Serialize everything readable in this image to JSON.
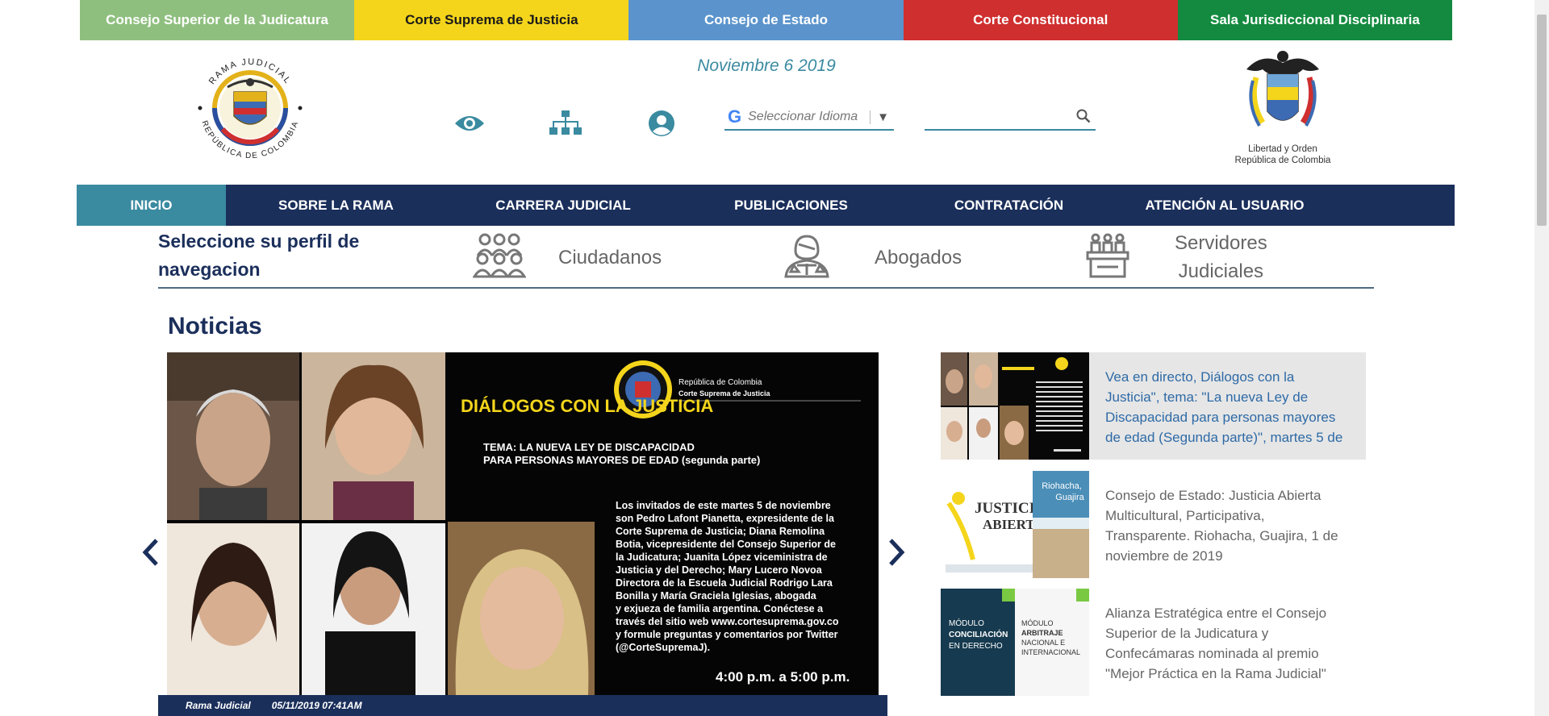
{
  "top_links": [
    {
      "label": "Consejo Superior de la Judicatura",
      "color": "#8fbf7f"
    },
    {
      "label": "Corte Suprema de Justicia",
      "color": "#f4d51b"
    },
    {
      "label": "Consejo de Estado",
      "color": "#5b94cc"
    },
    {
      "label": "Corte Constitucional",
      "color": "#cf2f2f"
    },
    {
      "label": "Sala Jurisdiccional Disciplinaria",
      "color": "#138a3f"
    }
  ],
  "header": {
    "left_logo_text_top": "RAMA JUDICIAL",
    "left_logo_text_bottom": "REPÚBLICA DE COLOMBIA",
    "date": "Noviembre 6 2019",
    "right_logo_caption_1": "Libertad y Orden",
    "right_logo_caption_2": "República de Colombia",
    "icons": [
      "eye-icon",
      "sitemap-icon",
      "user-circle-icon"
    ],
    "language_selector": {
      "label": "Seleccionar Idioma",
      "google_glyph": "G",
      "arrow": "▼"
    },
    "search": {
      "value": "",
      "placeholder": ""
    }
  },
  "nav": {
    "items": [
      {
        "label": "INICIO",
        "active": true
      },
      {
        "label": "SOBRE LA RAMA",
        "active": false
      },
      {
        "label": "CARRERA JUDICIAL",
        "active": false
      },
      {
        "label": "PUBLICACIONES",
        "active": false
      },
      {
        "label": "CONTRATACIÓN",
        "active": false
      },
      {
        "label": "ATENCIÓN AL USUARIO",
        "active": false
      }
    ],
    "active_color": "#3a8aa0",
    "bg_color": "#1b2f5b"
  },
  "profile": {
    "title_line1": "Seleccione su perfil de",
    "title_line2": "navegacion",
    "options": [
      {
        "label": "Ciudadanos",
        "icon": "citizens-icon"
      },
      {
        "label": "Abogados",
        "icon": "lawyer-icon"
      },
      {
        "label_line1": "Servidores",
        "label_line2": "Judiciales",
        "icon": "servants-icon"
      }
    ]
  },
  "news": {
    "title": "Noticias",
    "slide": {
      "heading": "DIÁLOGOS CON LA JUSTICIA",
      "topic_line1": "TEMA: LA NUEVA LEY DE DISCAPACIDAD",
      "topic_line2": "PARA PERSONAS MAYORES DE EDAD (segunda parte)",
      "seal_line1": "República de Colombia",
      "seal_line2": "Corte Suprema de Justicia",
      "body_lines": [
        "Los invitados de este martes 5 de noviembre",
        "son Pedro Lafont Pianetta, expresidente de la",
        "Corte Suprema de Justicia; Diana Remolina",
        "Botia, vicepresidente del Consejo Superior de",
        "la Judicatura; Juanita López viceministra de",
        "Justicia y del Derecho; Mary Lucero Novoa",
        "Directora de la Escuela Judicial Rodrigo Lara",
        "Bonilla y María Graciela Iglesias, abogada",
        "y exjueza de familia argentina. Conéctese a",
        "través del sitio web www.cortesuprema.gov.co",
        "y formule preguntas y comentarios por Twitter",
        "(@CorteSupremaJ)."
      ],
      "time": "4:00 p.m. a 5:00 p.m."
    },
    "caption_source": "Rama Judicial",
    "caption_date": "05/11/2019 07:41AM",
    "items": [
      {
        "text": "Vea en directo, Diálogos con la Justicia\", tema: \"La nueva Ley de Discapacidad para personas mayores de edad (Segunda parte)\", martes 5 de",
        "active": true
      },
      {
        "text": "Consejo de Estado: Justicia Abierta Multicultural, Participativa, Transparente. Riohacha, Guajira, 1 de noviembre de 2019",
        "active": false
      },
      {
        "text": "Alianza Estratégica entre el Consejo Superior de la Judicatura y Confecámaras nominada al premio \"Mejor Práctica en la Rama Judicial\"",
        "active": false
      }
    ],
    "thumb2_title_1": "JUSTICIA",
    "thumb2_title_2": "ABIERTA",
    "thumb2_side_1": "Riohacha,",
    "thumb2_side_2": "Guajira",
    "thumb3_col1_1": "MÓDULO",
    "thumb3_col1_2": "CONCILIACIÓN",
    "thumb3_col1_3": "EN DERECHO",
    "thumb3_col2_1": "MÓDULO",
    "thumb3_col2_2": "ARBITRAJE",
    "thumb3_col2_3": "NACIONAL E",
    "thumb3_col2_4": "INTERNACIONAL"
  }
}
